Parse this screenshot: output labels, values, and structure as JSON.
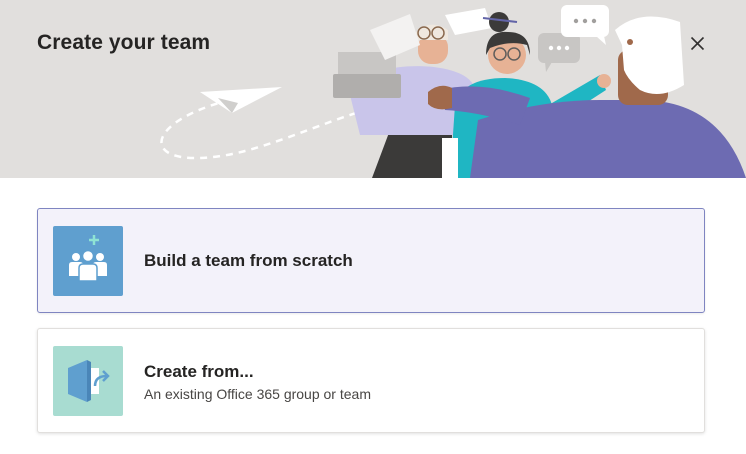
{
  "dialog": {
    "title": "Create your team",
    "close_icon": "close-icon",
    "header_illustration": "team-illustration"
  },
  "options": [
    {
      "title": "Build a team from scratch",
      "subtitle": "",
      "icon": "team-add-icon",
      "icon_bg": "#5f9fcf",
      "selected": true
    },
    {
      "title": "Create from...",
      "subtitle": "An existing Office 365 group or team",
      "icon": "office-group-icon",
      "icon_bg": "#a8dcd1",
      "selected": false
    }
  ],
  "colors": {
    "header_bg": "#e1dfdd",
    "selected_border": "#7f85c1",
    "selected_bg": "#f3f2fa"
  }
}
